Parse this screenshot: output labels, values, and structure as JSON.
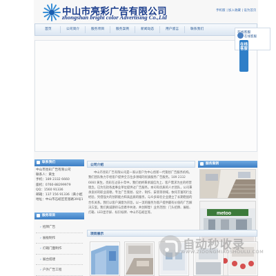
{
  "header": {
    "company_cn": "中山市亮彩广告有限公司",
    "company_en": "zhongshan bright color Advertising Co.,Ltd",
    "link_mobile": "手机版",
    "link_favorite": "| 加入收藏",
    "link_homepage": "| 设为首页"
  },
  "nav": {
    "items": [
      "首页",
      "公司简介",
      "服务项目",
      "服务案例",
      "新闻动态",
      "用户留言",
      "联系我们"
    ]
  },
  "online_service": {
    "tab_label": "在线客服",
    "title": "在线客服",
    "qq_label": "在线客服"
  },
  "contact": {
    "heading": "联系我们",
    "lines": [
      "中山市亮彩广告有限公司",
      "联系人：黄生",
      "手机：189 2332 6660",
      "座机：0760-88299979",
      "QQ：1560 91336",
      "邮箱：137 156 91336（黄小姐）",
      "地址：中山市石岐区宏基路39号13F"
    ]
  },
  "categories": {
    "heading": "服务项目",
    "items": [
      "招牌广告",
      "展板制作",
      "灯箱门面制作",
      "展台搭建",
      "户外广告工程"
    ]
  },
  "intro": {
    "heading": "公司介绍",
    "text": "中山市亮彩广告有限公司是一家以客户为中心创新一代策划广告服务机构。我们团队致力于给客户提供全方位多领域的优质服务广告服务。189 2332 6660 黄生，亮彩在过去十年中，我们始终秉承诚信为上、客户需求为主的经营理念，已为包括各类事业单位提供过广告服务。本司有优质的人才团队，公司秉承良好的职业道德，专注广告策划、设计、制作、安装等领域，依托丰富的行业经验，凭借强大的创新能力和高品质的服务，与众多知名企业建立了长期稳固的合作关系。我们以客户满意为宗旨，以一流的服务为客户提供最有价值的广告解决方案。我们真诚期待与您携手共进、共创辉煌！业务范围：门头招牌、展板、灯箱、LED显示屏、标识标牌、中山市石岐区等。"
  },
  "projects": {
    "heading": "项目展示"
  },
  "right_panel": {
    "heading": "服务案例"
  },
  "watermark": {
    "main": "自动秒收录",
    "sub": "WWW.ZIDONGMIAOSHOULU.COM"
  },
  "colors": {
    "brand_blue": "#2e5c96",
    "accent_blue": "#3c7ec4"
  }
}
